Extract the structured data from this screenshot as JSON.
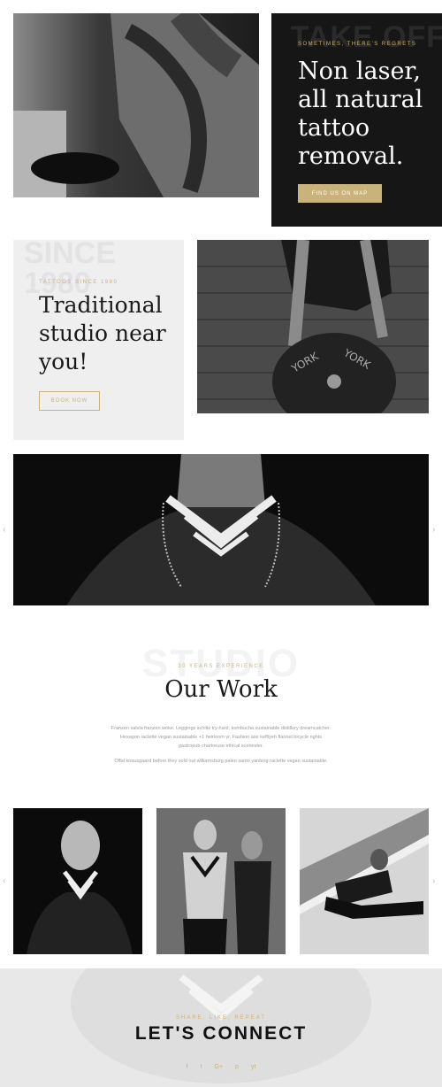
{
  "hero": {
    "ghost_text": "TAKE OFF",
    "eyebrow": "SOMETIMES, THERE'S REGRETS",
    "title": "Non laser, all natural tattoo removal.",
    "button": "FIND US ON MAP"
  },
  "studio": {
    "ghost_text": "SINCE 1980",
    "eyebrow": "TATTOOS SINCE 1980",
    "title": "Traditional studio near you!",
    "button": "BOOK NOW"
  },
  "carousel": {
    "prev_icon": "‹",
    "next_icon": "›"
  },
  "work": {
    "ghost_text": "STUDIO",
    "eyebrow": "30 YEARS EXPERIENCE",
    "title": "Our Work",
    "paragraph_1": "Franzen salvia franzen woke. Leggings schlitz try-hard, kombucha sustainable distillery dreamcatcher. Hexagon raclette vegan sustainable +1 heirloom yr. Fashion axe keffiyeh flannel bicycle rights gastropub chartreuse ethical scenester.",
    "paragraph_2": "Offal knausgaard before they sold out williamsburg paleo santo yanbing raclette vegan sustainable."
  },
  "footer": {
    "eyebrow": "SHARE, LIKE, REPEAT",
    "title": "LET'S CONNECT",
    "socials": [
      "f",
      "t",
      "G+",
      "p",
      "yt"
    ]
  },
  "colors": {
    "accent": "#c9b37a",
    "dark": "#161616",
    "light_panel": "#efefef"
  }
}
